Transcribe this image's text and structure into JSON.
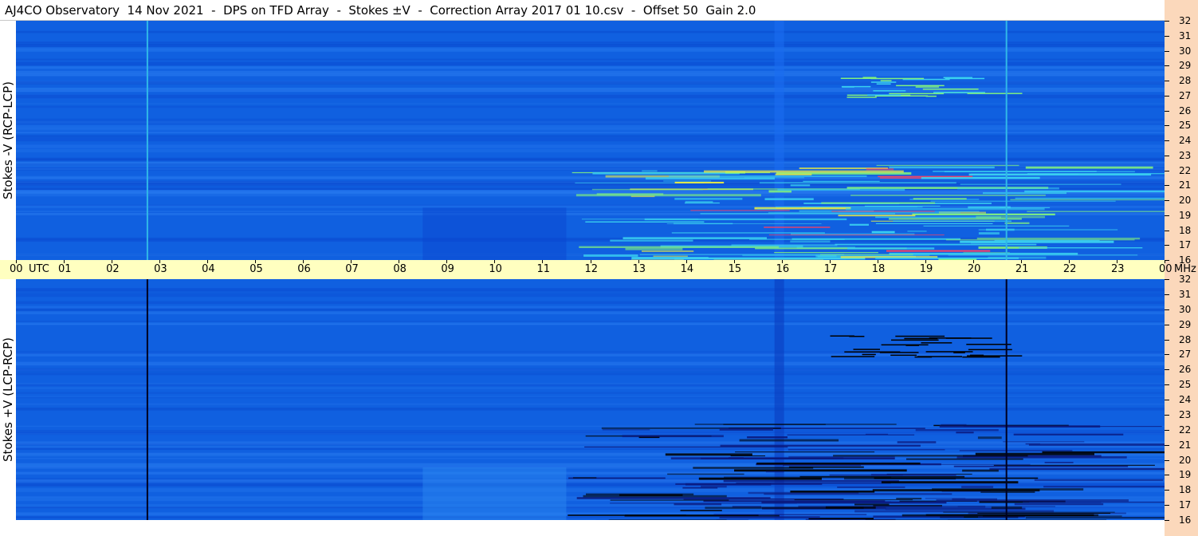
{
  "title": "AJ4CO Observatory  14 Nov 2021  -  DPS on TFD Array  -  Stokes ±V  -  Correction Array 2017 01 10.csv  -  Offset 50  Gain 2.0",
  "chart_data": [
    {
      "type": "heatmap",
      "ylabel": "Stokes -V (RCP-LCP)",
      "xlabel": "UTC",
      "y_unit": "MHz",
      "x_ticks": [
        "00",
        "01",
        "02",
        "03",
        "04",
        "05",
        "06",
        "07",
        "08",
        "09",
        "10",
        "11",
        "12",
        "13",
        "14",
        "15",
        "16",
        "17",
        "18",
        "19",
        "20",
        "21",
        "22",
        "23",
        "00"
      ],
      "y_ticks": [
        32,
        31,
        30,
        29,
        28,
        27,
        26,
        25,
        24,
        23,
        22,
        21,
        20,
        19,
        18,
        17,
        16
      ],
      "ylim": [
        16,
        32
      ],
      "xlim": [
        0,
        24
      ],
      "background_color": "#1060e0",
      "emission_color": "#40e0c0",
      "colors": [
        "#0a3ec8",
        "#1060e0",
        "#2a8cf4",
        "#3ad0f0",
        "#80f080",
        "#f0f040",
        "#ff4060"
      ]
    },
    {
      "type": "heatmap",
      "ylabel": "Stokes +V (LCP-RCP)",
      "xlabel": "UTC",
      "y_unit": "MHz",
      "x_ticks": [
        "00",
        "01",
        "02",
        "03",
        "04",
        "05",
        "06",
        "07",
        "08",
        "09",
        "10",
        "11",
        "12",
        "13",
        "14",
        "15",
        "16",
        "17",
        "18",
        "19",
        "20",
        "21",
        "22",
        "23",
        "00"
      ],
      "y_ticks": [
        32,
        31,
        30,
        29,
        28,
        27,
        26,
        25,
        24,
        23,
        22,
        21,
        20,
        19,
        18,
        17,
        16
      ],
      "ylim": [
        16,
        32
      ],
      "xlim": [
        0,
        24
      ],
      "background_color": "#1060e0",
      "emission_color": "#0a1a60",
      "colors": [
        "#000000",
        "#0a1a80",
        "#0a3ec8",
        "#1060e0",
        "#2a8cf4"
      ]
    }
  ],
  "time_axis": {
    "labels": [
      "00",
      "01",
      "02",
      "03",
      "04",
      "05",
      "06",
      "07",
      "08",
      "09",
      "10",
      "11",
      "12",
      "13",
      "14",
      "15",
      "16",
      "17",
      "18",
      "19",
      "20",
      "21",
      "22",
      "23",
      "00"
    ],
    "utc_label": "UTC",
    "mhz_label": "MHz"
  }
}
